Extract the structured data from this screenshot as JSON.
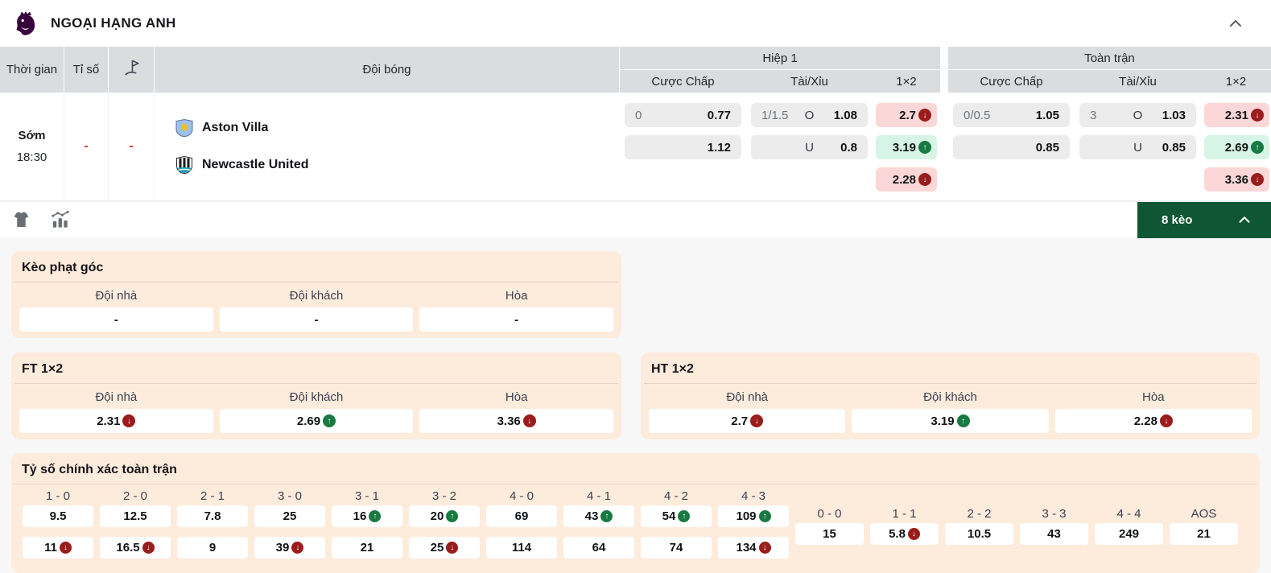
{
  "header": {
    "league": "NGOẠI HẠNG ANH"
  },
  "table": {
    "header": {
      "time": "Thời gian",
      "score": "Tỉ số",
      "teams": "Đội bóng",
      "first_half": "Hiệp 1",
      "full_time": "Toàn trận",
      "handicap": "Cược Chấp",
      "over_under": "Tài/Xỉu",
      "one_x_two": "1×2"
    },
    "match": {
      "time_label": "Sớm",
      "time": "18:30",
      "score": "-",
      "corners": "-",
      "home_team": "Aston Villa",
      "away_team": "Newcastle United"
    }
  },
  "odds": {
    "h1": {
      "handicap": [
        {
          "line": "0",
          "odds": "0.77"
        },
        {
          "line": "",
          "odds": "1.12"
        }
      ],
      "ou": [
        {
          "line": "1/1.5",
          "side": "O",
          "odds": "1.08"
        },
        {
          "line": "",
          "side": "U",
          "odds": "0.8"
        }
      ],
      "x12": [
        {
          "odds": "2.7",
          "trend": "down"
        },
        {
          "odds": "3.19",
          "trend": "up"
        },
        {
          "odds": "2.28",
          "trend": "down"
        }
      ]
    },
    "ft": {
      "handicap": [
        {
          "line": "0/0.5",
          "odds": "1.05"
        },
        {
          "line": "",
          "odds": "0.85"
        }
      ],
      "ou": [
        {
          "line": "3",
          "side": "O",
          "odds": "1.03"
        },
        {
          "line": "",
          "side": "U",
          "odds": "0.85"
        }
      ],
      "x12": [
        {
          "odds": "2.31",
          "trend": "down"
        },
        {
          "odds": "2.69",
          "trend": "up"
        },
        {
          "odds": "3.36",
          "trend": "down"
        }
      ]
    }
  },
  "toolbar": {
    "bets_label": "8 kèo"
  },
  "sections": {
    "corner": {
      "title": "Kèo phạt góc",
      "columns": [
        "Đội nhà",
        "Đội khách",
        "Hòa"
      ],
      "values": [
        {
          "odds": "-"
        },
        {
          "odds": "-"
        },
        {
          "odds": "-"
        }
      ]
    },
    "ft12": {
      "title": "FT 1×2",
      "columns": [
        "Đội nhà",
        "Đội khách",
        "Hòa"
      ],
      "values": [
        {
          "odds": "2.31",
          "trend": "down"
        },
        {
          "odds": "2.69",
          "trend": "up"
        },
        {
          "odds": "3.36",
          "trend": "down"
        }
      ]
    },
    "ht12": {
      "title": "HT 1×2",
      "columns": [
        "Đội nhà",
        "Đội khách",
        "Hòa"
      ],
      "values": [
        {
          "odds": "2.7",
          "trend": "down"
        },
        {
          "odds": "3.19",
          "trend": "up"
        },
        {
          "odds": "2.28",
          "trend": "down"
        }
      ]
    },
    "correct_score": {
      "title": "Tỷ số chính xác toàn trận",
      "main": [
        {
          "score": "1 - 0",
          "top": {
            "odds": "9.5"
          },
          "bottom": {
            "odds": "11",
            "trend": "down"
          }
        },
        {
          "score": "2 - 0",
          "top": {
            "odds": "12.5"
          },
          "bottom": {
            "odds": "16.5",
            "trend": "down"
          }
        },
        {
          "score": "2 - 1",
          "top": {
            "odds": "7.8"
          },
          "bottom": {
            "odds": "9"
          }
        },
        {
          "score": "3 - 0",
          "top": {
            "odds": "25"
          },
          "bottom": {
            "odds": "39",
            "trend": "down"
          }
        },
        {
          "score": "3 - 1",
          "top": {
            "odds": "16",
            "trend": "up"
          },
          "bottom": {
            "odds": "21"
          }
        },
        {
          "score": "3 - 2",
          "top": {
            "odds": "20",
            "trend": "up"
          },
          "bottom": {
            "odds": "25",
            "trend": "down"
          }
        },
        {
          "score": "4 - 0",
          "top": {
            "odds": "69"
          },
          "bottom": {
            "odds": "114"
          }
        },
        {
          "score": "4 - 1",
          "top": {
            "odds": "43",
            "trend": "up"
          },
          "bottom": {
            "odds": "64"
          }
        },
        {
          "score": "4 - 2",
          "top": {
            "odds": "54",
            "trend": "up"
          },
          "bottom": {
            "odds": "74"
          }
        },
        {
          "score": "4 - 3",
          "top": {
            "odds": "109",
            "trend": "up"
          },
          "bottom": {
            "odds": "134",
            "trend": "down"
          }
        }
      ],
      "draws": [
        {
          "score": "0 - 0",
          "odds": "15"
        },
        {
          "score": "1 - 1",
          "odds": "5.8",
          "trend": "down"
        },
        {
          "score": "2 - 2",
          "odds": "10.5"
        },
        {
          "score": "3 - 3",
          "odds": "43"
        },
        {
          "score": "4 - 4",
          "odds": "249"
        },
        {
          "score": "AOS",
          "odds": "21"
        }
      ]
    }
  },
  "colors": {
    "brand_purple": "#38003c",
    "accent_green": "#0e5634",
    "trend_up": "#187a41",
    "trend_down": "#9b1c1c",
    "up_bg": "#d6f5e6",
    "down_bg": "#fbd7d7",
    "card_bg": "#fdebdc",
    "header_gray": "#dbdcdd",
    "odds_gray": "#ececec",
    "score_red": "#e03131"
  }
}
